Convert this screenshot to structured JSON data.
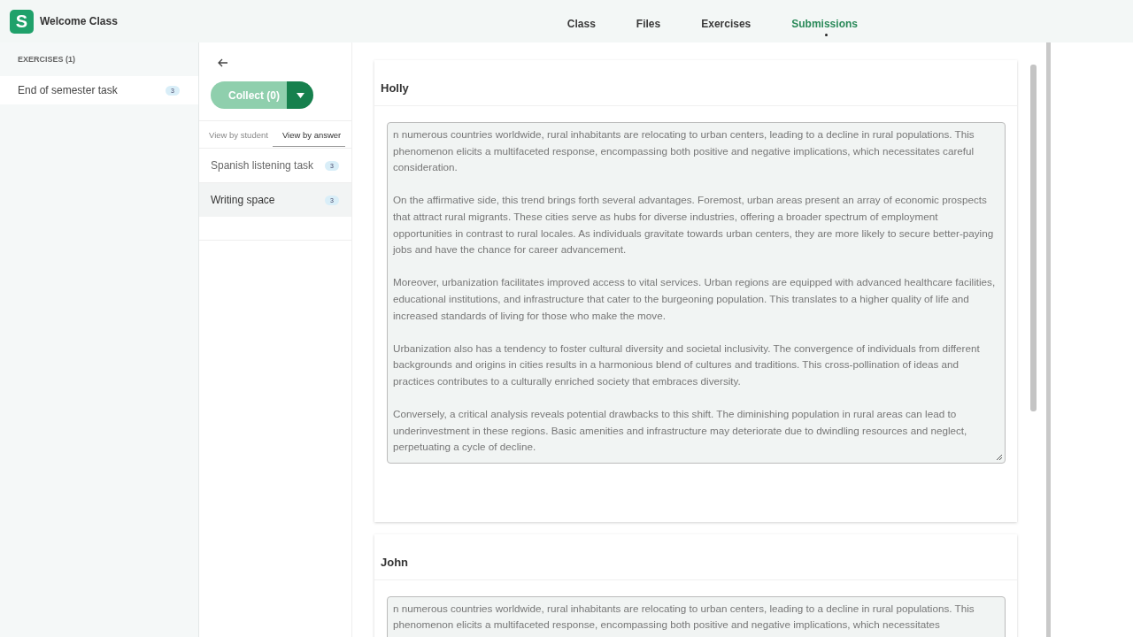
{
  "header": {
    "logo_letter": "S",
    "class_name": "Welcome Class",
    "nav": [
      {
        "label": "Class",
        "selected": false
      },
      {
        "label": "Files",
        "selected": false
      },
      {
        "label": "Exercises",
        "selected": false
      },
      {
        "label": "Submissions",
        "selected": true
      }
    ]
  },
  "sidebar": {
    "heading": "EXERCISES (1)",
    "items": [
      {
        "label": "End of semester task",
        "count": "3",
        "selected": true
      }
    ]
  },
  "middle": {
    "collect_button": "Collect (0)",
    "view_tabs": [
      {
        "label": "View by student",
        "selected": false
      },
      {
        "label": "View by answer",
        "selected": true
      }
    ],
    "items": [
      {
        "label": "Spanish listening task",
        "count": "3",
        "selected": false
      },
      {
        "label": "Writing space",
        "count": "3",
        "selected": true
      }
    ]
  },
  "submissions": [
    {
      "student": "Holly",
      "paragraphs": [
        "n numerous countries worldwide, rural inhabitants are relocating to urban centers, leading to a decline in rural populations. This phenomenon elicits a multifaceted response, encompassing both positive and negative implications, which necessitates careful consideration.",
        "On the affirmative side, this trend brings forth several advantages. Foremost, urban areas present an array of economic prospects that attract rural migrants. These cities serve as hubs for diverse industries, offering a broader spectrum of employment opportunities in contrast to rural locales. As individuals gravitate towards urban centers, they are more likely to secure better-paying jobs and have the chance for career advancement.",
        "Moreover, urbanization facilitates improved access to vital services. Urban regions are equipped with advanced healthcare facilities, educational institutions, and infrastructure that cater to the burgeoning population. This translates to a higher quality of life and increased standards of living for those who make the move.",
        "Urbanization also has a tendency to foster cultural diversity and societal inclusivity. The convergence of individuals from different backgrounds and origins in cities results in a harmonious blend of cultures and traditions. This cross-pollination of ideas and practices contributes to a culturally enriched society that embraces diversity.",
        "Conversely, a critical analysis reveals potential drawbacks to this shift. The diminishing population in rural areas can lead to underinvestment in these regions. Basic amenities and infrastructure may deteriorate due to dwindling resources and neglect, perpetuating a cycle of decline."
      ]
    },
    {
      "student": "John",
      "paragraphs": [
        "n numerous countries worldwide, rural inhabitants are relocating to urban centers, leading to a decline in rural populations. This phenomenon elicits a multifaceted response, encompassing both positive and negative implications, which necessitates"
      ]
    }
  ]
}
